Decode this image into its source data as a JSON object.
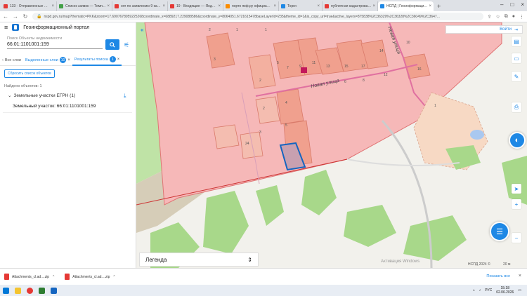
{
  "browser": {
    "tabs": [
      {
        "title": "133 · Отправленные — Я...",
        "color": "#e53935"
      },
      {
        "title": "Список заявок — Темп...",
        "color": "#43a047"
      },
      {
        "title": "огл по заявлению 9 кад...",
        "color": "#e53935"
      },
      {
        "title": "19 · Входящие — Яндекс...",
        "color": "#e53935"
      },
      {
        "title": "порто пкф.ру официально...",
        "color": "#fb8c00"
      },
      {
        "title": "Торги",
        "color": "#1e88e5"
      },
      {
        "title": "публичная кадастровая...",
        "color": "#e53935"
      },
      {
        "title": "НСПД | Геоинформационны...",
        "color": "#1e88e5",
        "active": true
      }
    ],
    "new_tab": "+",
    "url": "nspd.gov.ru/map?thematic=PKK&zoom=17.6907678959225268coordinate_x=6889217.229088586&coordinate_y=8064051.6721615478baseLayerId=235&theme_id=1&is_copy_url=true&active_layers=875838%2C36329%2C36328%2C36049%2C3647..."
  },
  "portal": {
    "title": "Геоинформационный портал",
    "search_label": "Поиск Объекты недвижимости",
    "search_value": "66:01:1101001:159",
    "tabs": [
      {
        "label": "Все слои"
      },
      {
        "label": "Выделенные слои",
        "count": "10"
      },
      {
        "label": "Результаты поиска",
        "count": "1"
      }
    ],
    "reset_label": "Сбросить список объектов",
    "found_label": "Найдено объектов: 1",
    "group_label": "Земельные участки ЕГРН (1)",
    "parcel_label": "Земельный участок: 66:01:1101001:159"
  },
  "map": {
    "login_label": "Войти",
    "street_label_1": "Новая улица",
    "street_label_2": "Новая улица",
    "legend_label": "Легенда",
    "watermark": "Активация Windows",
    "scale_label": "НСПД 2024 ©",
    "scale_value": "20 м",
    "house_numbers": [
      "2",
      "1",
      "3",
      "5",
      "7",
      "9",
      "11",
      "13",
      "15",
      "17",
      "12",
      "14",
      "16",
      "10",
      "8",
      "6",
      "4",
      "2",
      "24",
      "1",
      "2",
      "5",
      "3",
      "1"
    ]
  },
  "downloads": {
    "items": [
      {
        "name": "Attachments_cl.ad....zip"
      },
      {
        "name": "Attachments_cl.ad....zip"
      }
    ],
    "show_all": "Показать все"
  },
  "taskbar": {
    "lang": "РУС",
    "time": "15:18",
    "date": "02.06.2026"
  },
  "colors": {
    "accent": "#1e88e5",
    "zone_pink": "#f6b8b8",
    "parcel_salmon": "#f0a08e",
    "green": "#a8d88a",
    "selected_parcel": "#1565c0"
  }
}
